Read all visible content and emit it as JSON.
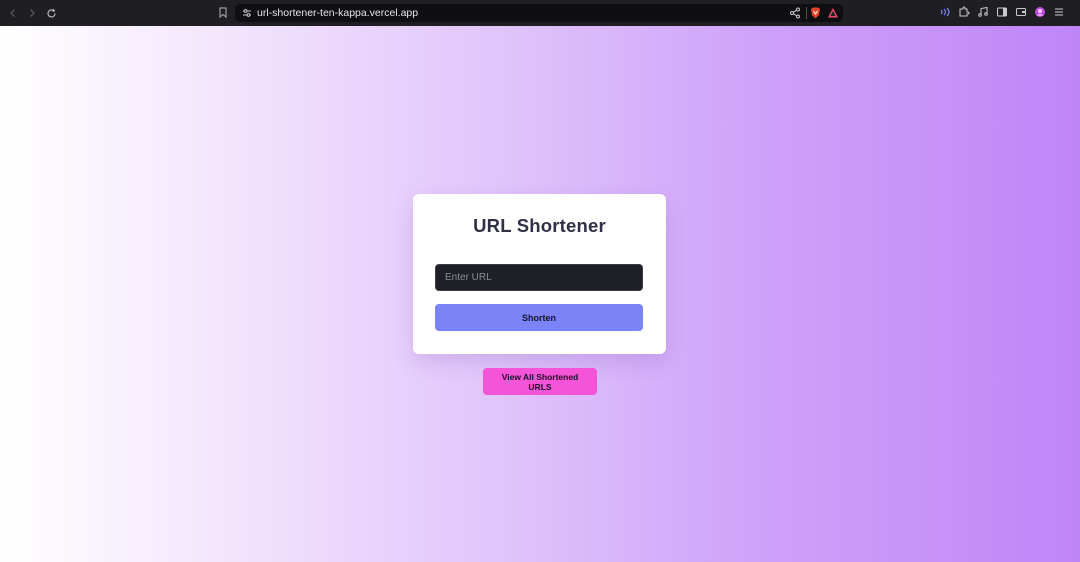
{
  "browser": {
    "url": "url-shortener-ten-kappa.vercel.app",
    "icons": [
      "back-icon",
      "forward-icon",
      "reload-icon",
      "bookmark-icon",
      "site-settings-icon",
      "share-icon",
      "brave-shields-icon",
      "brave-rewards-icon",
      "leo-ai-icon",
      "extensions-icon",
      "media-icon",
      "sidebar-icon",
      "wallet-icon",
      "profile-icon",
      "menu-icon"
    ]
  },
  "card": {
    "title": "URL Shortener",
    "input_placeholder": "Enter URL",
    "input_value": "",
    "shorten_label": "Shorten"
  },
  "view_all_label": "View All Shortened URLS",
  "colors": {
    "card_bg": "#ffffff",
    "input_bg": "#1e2025",
    "shorten_bg": "#7b83f7",
    "view_all_bg": "#f553d8",
    "gradient_start": "#ffffff",
    "gradient_end": "#bf85f8"
  }
}
